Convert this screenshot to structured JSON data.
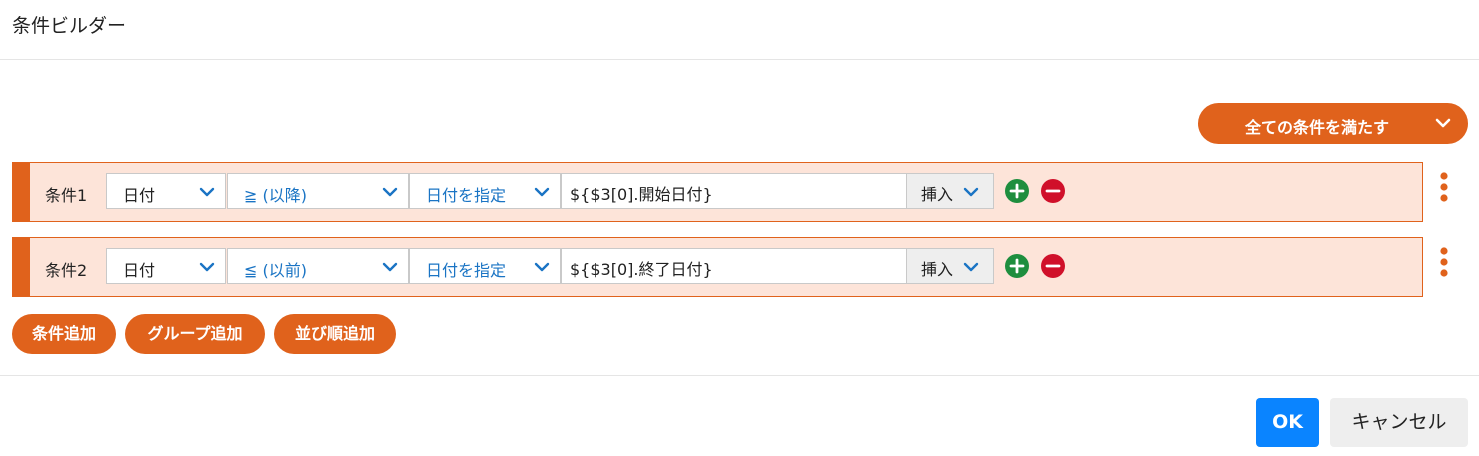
{
  "dialog": {
    "title": "条件ビルダー"
  },
  "match_mode": {
    "label": "全ての条件を満たす",
    "icon": "chevron-down-icon"
  },
  "conditions": [
    {
      "label": "条件1",
      "field": "日付",
      "operator": "≧ (以降)",
      "value_mode": "日付を指定",
      "value": "${$3[0].開始日付}",
      "insert_label": "挿入"
    },
    {
      "label": "条件2",
      "field": "日付",
      "operator": "≦ (以前)",
      "value_mode": "日付を指定",
      "value": "${$3[0].終了日付}",
      "insert_label": "挿入"
    }
  ],
  "actions": {
    "add_condition": "条件追加",
    "add_group": "グループ追加",
    "add_sort": "並び順追加"
  },
  "footer": {
    "ok": "OK",
    "cancel": "キャンセル"
  },
  "colors": {
    "accent": "#e0621c",
    "row_bg": "#fde4d9",
    "link_blue": "#1a74c4",
    "primary": "#0a84ff",
    "add_green": "#1e8e3e",
    "remove_red": "#d0102a"
  }
}
